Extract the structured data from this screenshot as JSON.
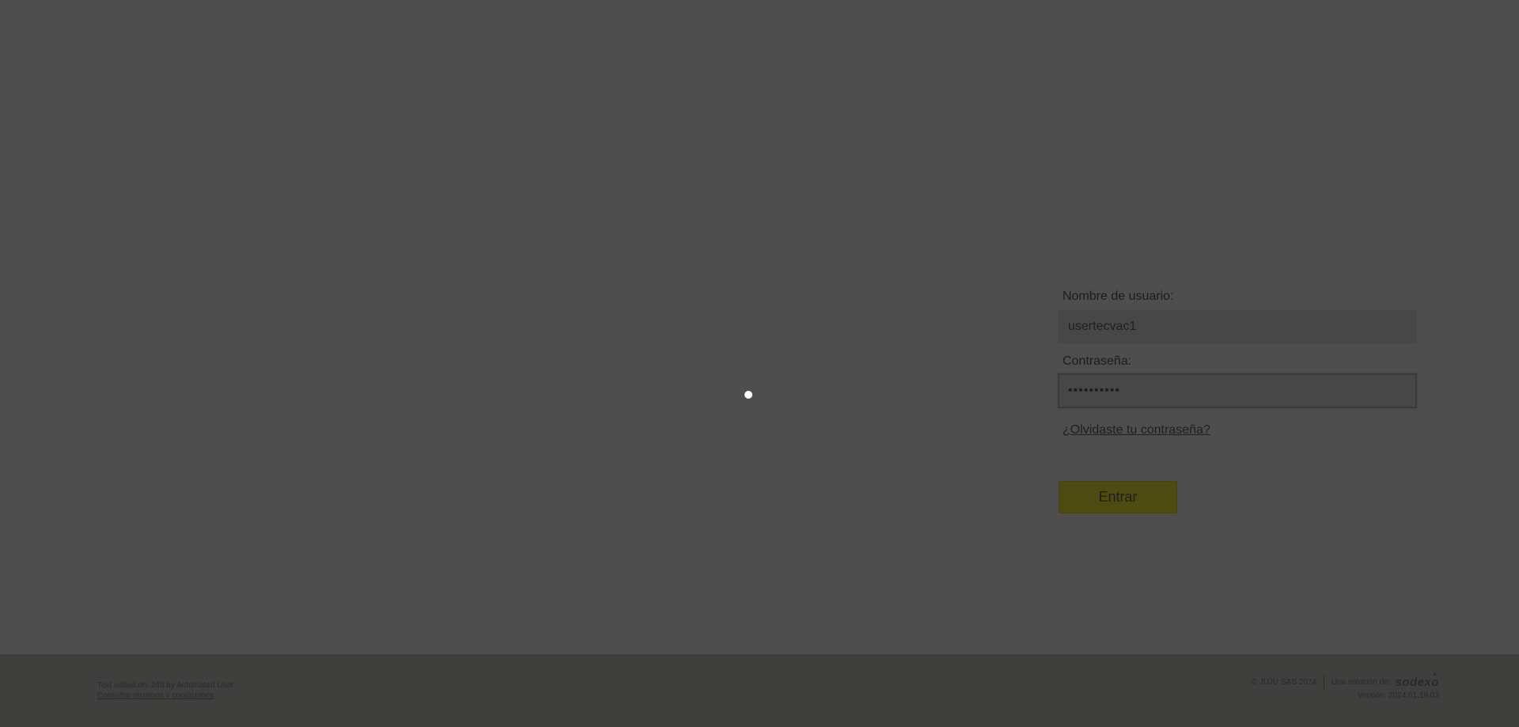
{
  "login": {
    "username_label": "Nombre de usuario:",
    "username_value": "usertecvac1",
    "password_label": "Contraseña:",
    "password_value": "••••••••••",
    "forgot_link": "¿Olvidaste tu contraseña?",
    "submit_label": "Entrar"
  },
  "footer": {
    "edited_text": "Text edited on: 248 by Automated User",
    "terms_link": "Consultar términos y condiciones",
    "copyright": "© JUJU SAS 2024",
    "solution_label": "Una solución de:",
    "brand_logo": "sodexo",
    "version": "Versión: 2024.01.19.03"
  },
  "colors": {
    "overlay_background": "#4e4e4e",
    "footer_background": "#3f3f3d",
    "button_background": "#4e4b12",
    "loader_dot": "#ffffff"
  }
}
